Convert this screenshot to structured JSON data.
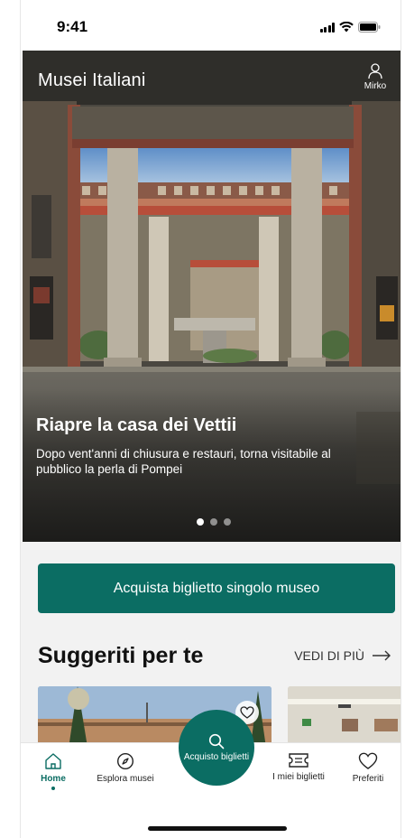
{
  "status_bar": {
    "time": "9:41"
  },
  "header": {
    "title": "Musei Italiani",
    "user_name": "Mirko",
    "user_icon": "person-icon"
  },
  "hero": {
    "headline": "Riapre la casa dei Vettii",
    "subtitle": "Dopo vent'anni di chiusura e restauri, torna visitabile al pubblico la perla di Pompei",
    "carousel_count": 3,
    "carousel_active": 1
  },
  "main": {
    "buy_button": "Acquista biglietto singolo museo",
    "section_title": "Suggeriti per te",
    "see_more": "VEDI DI PIÙ",
    "see_more_icon": "arrow-right-icon"
  },
  "bottom_nav": {
    "items": [
      {
        "label": "Home",
        "icon": "home-icon",
        "active": true
      },
      {
        "label": "Esplora musei",
        "icon": "compass-icon",
        "active": false
      },
      {
        "label": "I miei biglietti",
        "icon": "ticket-icon",
        "active": false
      },
      {
        "label": "Preferiti",
        "icon": "heart-icon",
        "active": false
      }
    ],
    "fab": {
      "label": "Acquisto biglietti",
      "icon": "search-icon"
    }
  },
  "colors": {
    "brand": "#0b6d63",
    "content_bg": "#f2f2f2"
  }
}
